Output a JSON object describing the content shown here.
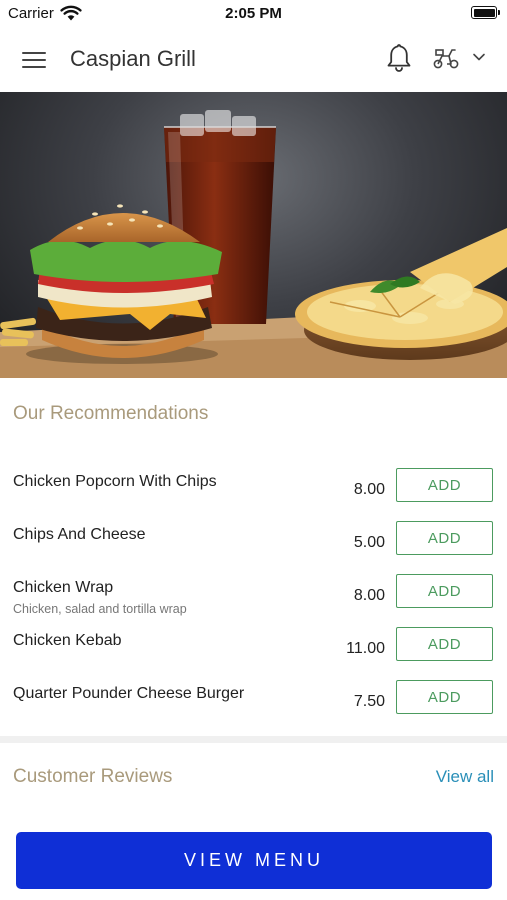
{
  "status_bar": {
    "carrier": "Carrier",
    "time": "2:05 PM"
  },
  "header": {
    "title": "Caspian Grill"
  },
  "hero": {
    "image": "burger-cola-pizza-photo"
  },
  "recommendations": {
    "title": "Our Recommendations",
    "items": [
      {
        "name": "Chicken Popcorn With Chips",
        "description": "",
        "price": "8.00",
        "button": "ADD"
      },
      {
        "name": "Chips And Cheese",
        "description": "",
        "price": "5.00",
        "button": "ADD"
      },
      {
        "name": "Chicken Wrap",
        "description": "Chicken, salad and tortilla wrap",
        "price": "8.00",
        "button": "ADD"
      },
      {
        "name": "Chicken Kebab",
        "description": "",
        "price": "11.00",
        "button": "ADD"
      },
      {
        "name": "Quarter Pounder Cheese Burger",
        "description": "",
        "price": "7.50",
        "button": "ADD"
      }
    ]
  },
  "reviews": {
    "title": "Customer Reviews",
    "view_all": "View all"
  },
  "footer": {
    "view_menu": "VIEW MENU"
  },
  "colors": {
    "accent_title": "#a99a7c",
    "add_green": "#4c9b5f",
    "link_blue": "#2a8fb8",
    "primary_button": "#0f2fd6"
  },
  "icons": [
    "menu-icon",
    "bell-icon",
    "scooter-icon",
    "chevron-down-icon",
    "wifi-icon",
    "battery-icon"
  ]
}
